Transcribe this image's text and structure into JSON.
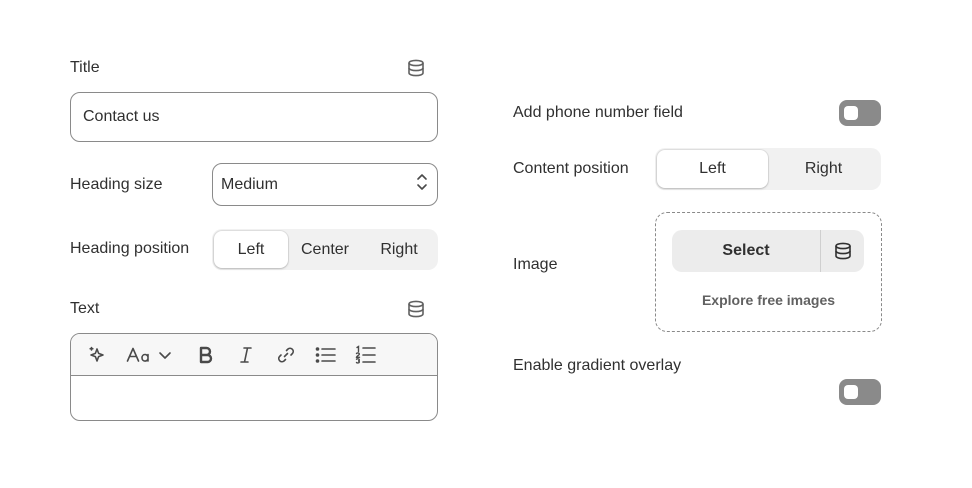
{
  "left": {
    "title": {
      "label": "Title",
      "value": "Contact us"
    },
    "heading_size": {
      "label": "Heading size",
      "value": "Medium"
    },
    "heading_position": {
      "label": "Heading position",
      "options": [
        "Left",
        "Center",
        "Right"
      ],
      "selected": "Left"
    },
    "text": {
      "label": "Text",
      "toolbar": [
        "sparkle-icon",
        "font-style-icon",
        "chevron-down-icon",
        "bold-icon",
        "italic-icon",
        "link-icon",
        "bullet-list-icon",
        "numbered-list-icon"
      ],
      "value": ""
    }
  },
  "right": {
    "phone_field": {
      "label": "Add phone number field",
      "on": false
    },
    "content_position": {
      "label": "Content position",
      "options": [
        "Left",
        "Right"
      ],
      "selected": "Left"
    },
    "image": {
      "label": "Image",
      "select_label": "Select",
      "explore_label": "Explore free images"
    },
    "gradient_overlay": {
      "label": "Enable gradient overlay",
      "on": false
    }
  },
  "colors": {
    "border": "#8a8a8a",
    "text": "#303030",
    "segment_bg": "#f1f1f1",
    "toggle_off": "#8a8a8a"
  }
}
